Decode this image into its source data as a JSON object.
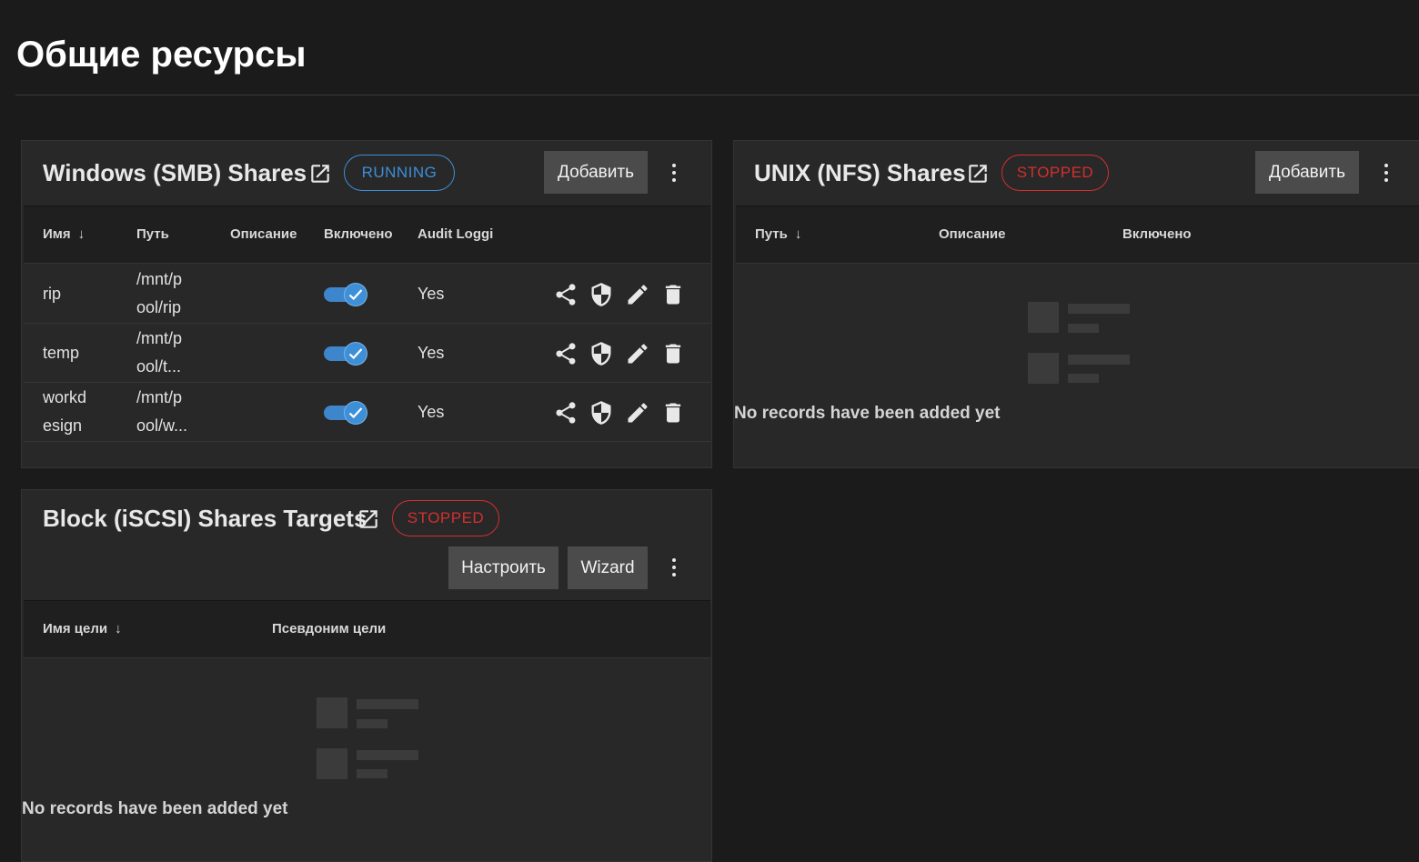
{
  "page": {
    "title": "Общие ресурсы"
  },
  "smb": {
    "title": "Windows (SMB) Shares",
    "status": "RUNNING",
    "add_label": "Добавить",
    "columns": {
      "name": "Имя",
      "path": "Путь",
      "description": "Описание",
      "enabled": "Включено",
      "audit": "Audit Loggi"
    },
    "rows": [
      {
        "name_line1": "rip",
        "name_line2": "",
        "path_line1": "/mnt/p",
        "path_line2": "ool/rip",
        "enabled": true,
        "audit": "Yes"
      },
      {
        "name_line1": "temp",
        "name_line2": "",
        "path_line1": "/mnt/p",
        "path_line2": "ool/t...",
        "enabled": true,
        "audit": "Yes"
      },
      {
        "name_line1": "workd",
        "name_line2": "esign",
        "path_line1": "/mnt/p",
        "path_line2": "ool/w...",
        "enabled": true,
        "audit": "Yes"
      }
    ]
  },
  "nfs": {
    "title": "UNIX (NFS) Shares",
    "status": "STOPPED",
    "add_label": "Добавить",
    "columns": {
      "path": "Путь",
      "description": "Описание",
      "enabled": "Включено"
    },
    "empty_text": "No records have been added yet"
  },
  "iscsi": {
    "title": "Block (iSCSI) Shares Targets",
    "status": "STOPPED",
    "configure_label": "Настроить",
    "wizard_label": "Wizard",
    "columns": {
      "target_name": "Имя цели",
      "target_alias": "Псевдоним цели"
    },
    "empty_text": "No records have been added yet"
  },
  "colors": {
    "background": "#1b1b1b",
    "card": "#282828",
    "running": "#3d8fd8",
    "stopped": "#d32f2f",
    "button": "#4b4b4b"
  },
  "icons": [
    "open-in-new-icon",
    "more-vert-icon",
    "share-icon",
    "security-shield-icon",
    "edit-pencil-icon",
    "delete-trash-icon",
    "arrow-down-icon",
    "check-icon",
    "empty-list-icon"
  ]
}
